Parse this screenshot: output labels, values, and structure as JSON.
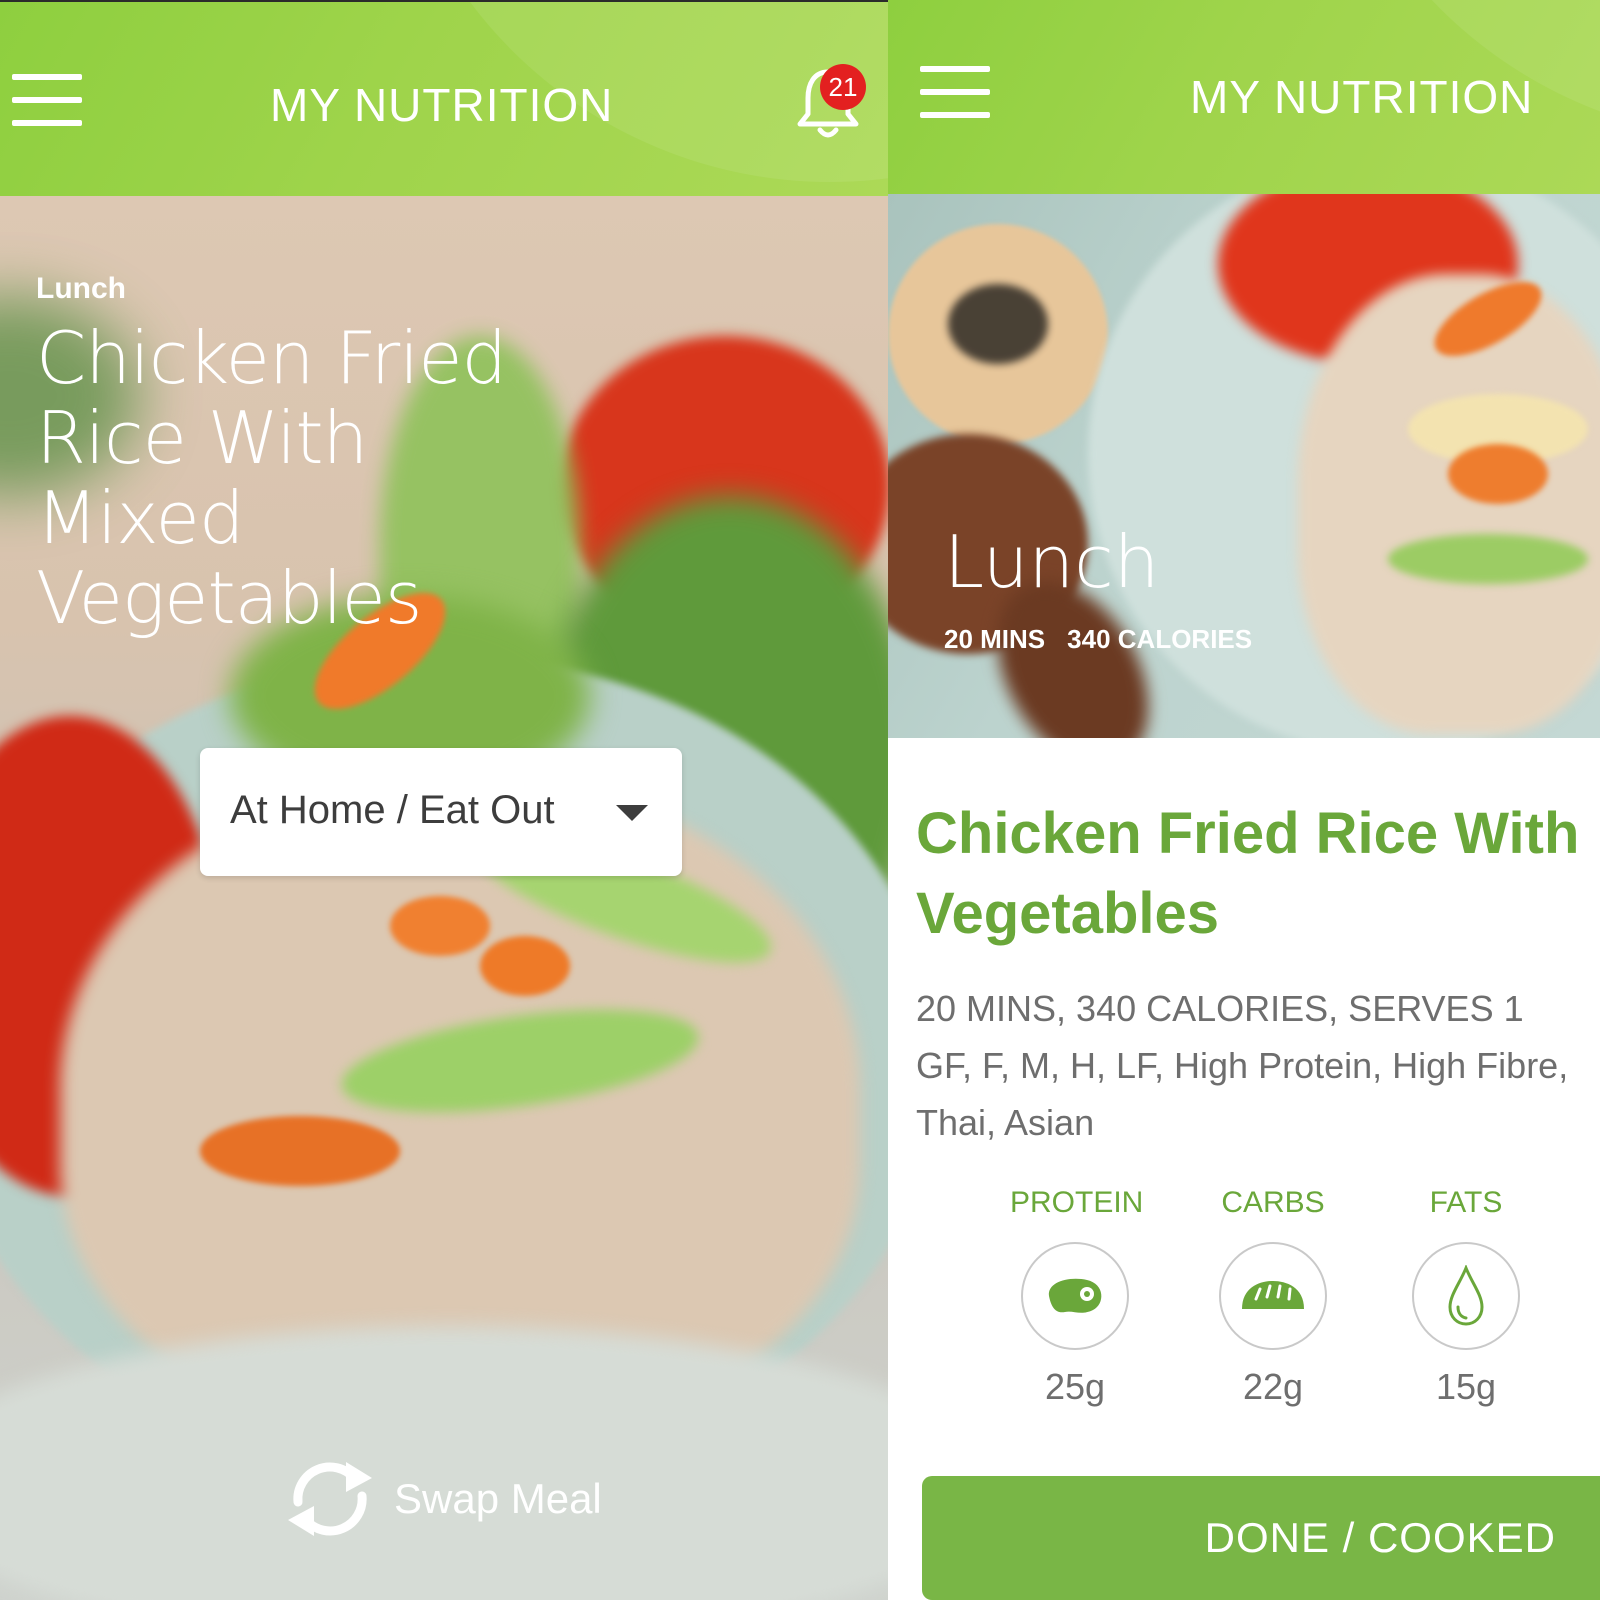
{
  "left_screen": {
    "header": {
      "title": "MY NUTRITION",
      "notification_count": "21"
    },
    "meal": {
      "label": "Lunch",
      "title": "Chicken Fried Rice With Mixed Vegetables"
    },
    "location_select": {
      "selected": "At Home / Eat Out"
    },
    "swap_label": "Swap Meal"
  },
  "right_screen": {
    "header": {
      "title": "MY NUTRITION"
    },
    "hero": {
      "label": "Lunch",
      "time": "20 MINS",
      "calories": "340 CALORIES"
    },
    "recipe": {
      "title_line1": "Chicken Fried Rice With",
      "title_line2": "Vegetables",
      "summary": "20 MINS, 340 CALORIES, SERVES 1",
      "tags_line1": "GF, F, M, H, LF, High Protein, High Fibre,",
      "tags_line2": "Thai, Asian"
    },
    "macros": [
      {
        "label": "PROTEIN",
        "value": "25g",
        "icon": "steak-icon"
      },
      {
        "label": "CARBS",
        "value": "22g",
        "icon": "bread-icon"
      },
      {
        "label": "FATS",
        "value": "15g",
        "icon": "drop-icon"
      }
    ],
    "done_label": "DONE / COOKED"
  },
  "colors": {
    "header_green": "#9fd44b",
    "accent_green": "#6aa73a",
    "button_green": "#79b646",
    "badge_red": "#e32020",
    "body_text": "#6e6e6e"
  }
}
